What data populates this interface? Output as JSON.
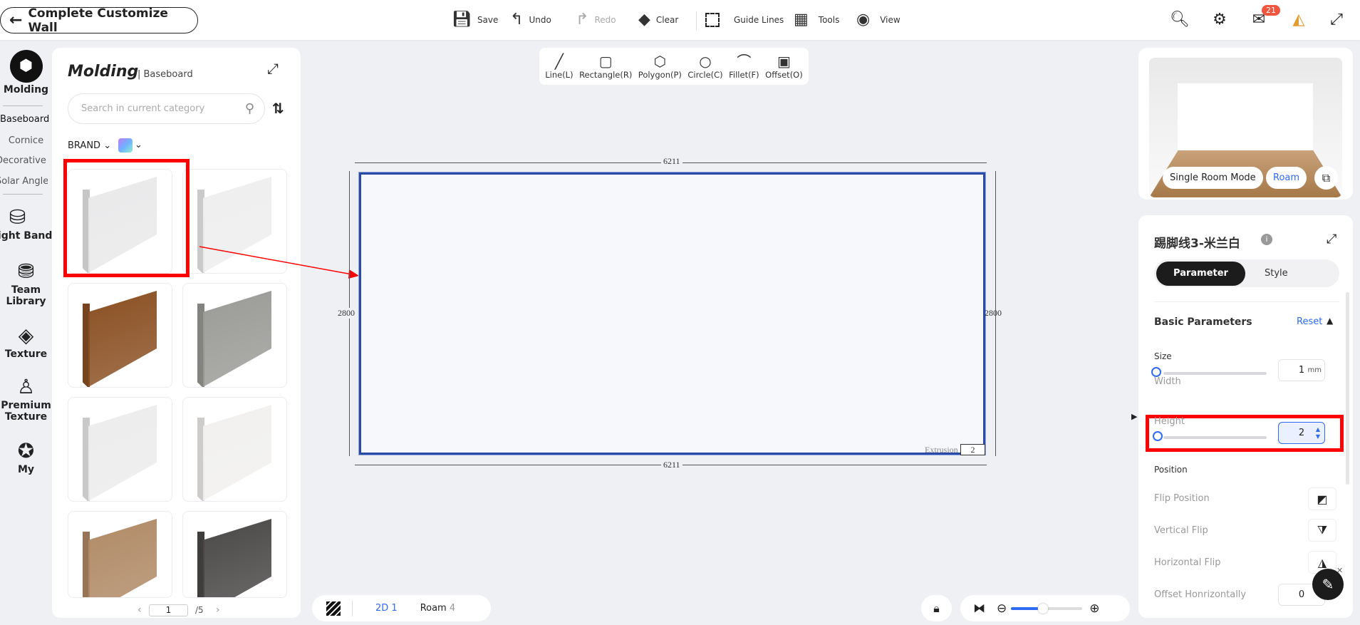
{
  "header": {
    "back_label": "Complete Customize Wall",
    "toolbar": [
      {
        "label": "Save",
        "icon": "save-icon"
      },
      {
        "label": "Undo",
        "icon": "undo-icon"
      },
      {
        "label": "Redo",
        "icon": "redo-icon",
        "disabled": true
      },
      {
        "label": "Clear",
        "icon": "eraser-icon"
      },
      {
        "label": "Guide Lines",
        "icon": "guide-lines-icon"
      },
      {
        "label": "Tools",
        "icon": "tools-icon"
      },
      {
        "label": "View",
        "icon": "eye-icon"
      }
    ],
    "notification_count": "21"
  },
  "rail": {
    "items": [
      {
        "label": "Molding",
        "active": true
      },
      {
        "label": "Light Band"
      },
      {
        "label": "Team Library"
      },
      {
        "label": "Texture"
      },
      {
        "label": "Premium Texture"
      },
      {
        "label": "My"
      }
    ],
    "subitems": [
      "Baseboard",
      "Cornice",
      "Decorative Molding",
      "Solar Angle Line"
    ]
  },
  "library": {
    "title": "Molding",
    "subtitle": "Baseboard",
    "search_placeholder": "Search in current category",
    "brand_filter": "BRAND",
    "page": "1",
    "total_pages": "/5",
    "products": [
      {
        "material": "white plain",
        "color": "#e9e9ea"
      },
      {
        "material": "white ornate",
        "color": "#eeeeef"
      },
      {
        "material": "walnut wood",
        "color": "#8a4f22"
      },
      {
        "material": "grey stone",
        "color": "#9a9b97"
      },
      {
        "material": "white profiled",
        "color": "#ececec"
      },
      {
        "material": "white marble",
        "color": "#f1f0ee"
      },
      {
        "material": "oak wood",
        "color": "#b08a66"
      },
      {
        "material": "dark marble",
        "color": "#4a4747"
      }
    ]
  },
  "draw_tools": [
    "Line(L)",
    "Rectangle(R)",
    "Polygon(P)",
    "Circle(C)",
    "Fillet(F)",
    "Offset(O)"
  ],
  "canvas": {
    "top_dim": "6211",
    "bottom_dim": "6211",
    "left_dim": "2800",
    "right_dim": "2800",
    "extrusion_label": "Extrusion",
    "extrusion_value": "2"
  },
  "bottom": {
    "view_2d": "2D 1",
    "roam_label": "Roam",
    "roam_count": "4",
    "zoom_level": 0.45
  },
  "preview": {
    "mode_button": "Single Room Mode",
    "roam_button": "Roam"
  },
  "properties": {
    "title": "踢脚线3-米兰白",
    "tabs": [
      "Parameter",
      "Style"
    ],
    "section": "Basic Parameters",
    "reset": "Reset",
    "size_label": "Size",
    "width_label": "Width",
    "width_value": "1",
    "width_unit": "mm",
    "height_label": "Height",
    "height_value": "2",
    "position_label": "Position",
    "flip_position": "Flip Position",
    "vertical_flip": "Vertical Flip",
    "horizontal_flip": "Horizontal Flip",
    "offset_h": "Offset Honrizontally",
    "offset_h_value": "0"
  },
  "colors": {
    "accent": "#2e6bf0",
    "highlight": "#ff0000",
    "selection": "#2b4aa8"
  }
}
